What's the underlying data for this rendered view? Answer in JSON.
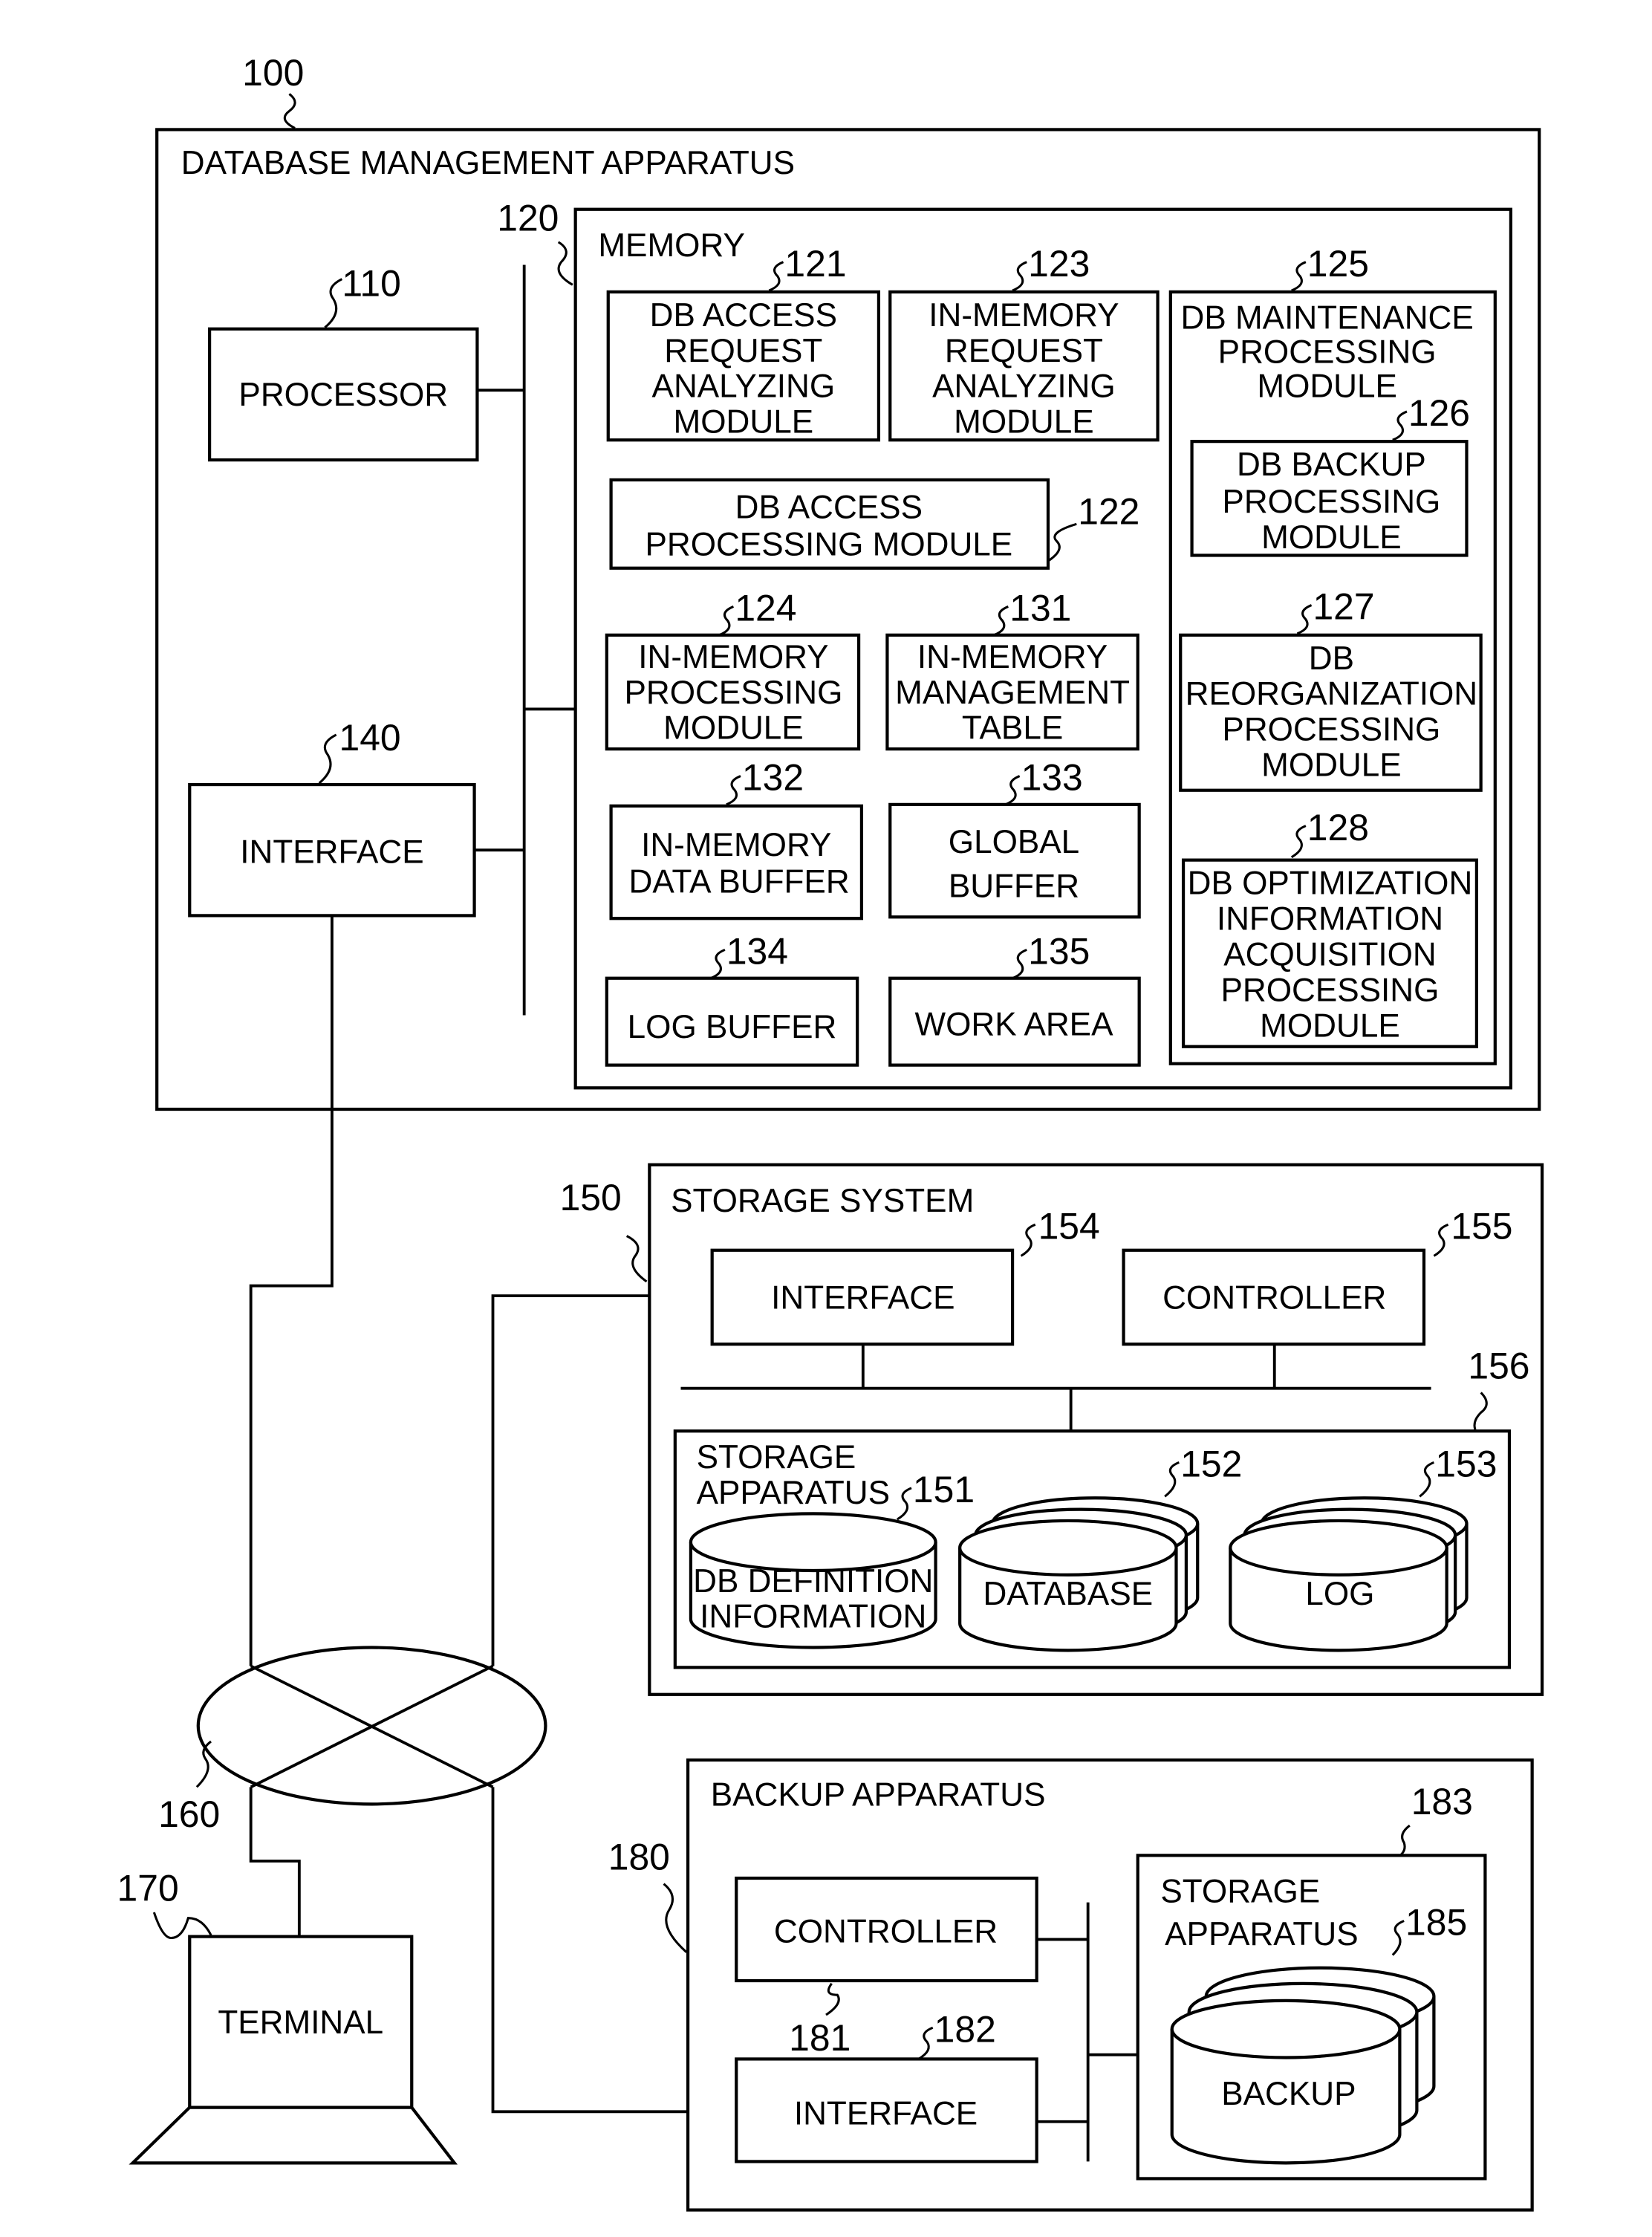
{
  "figure": {
    "dbms": {
      "ref": "100",
      "title": "DATABASE MANAGEMENT APPARATUS",
      "processor": {
        "ref": "110",
        "label": "PROCESSOR"
      },
      "interface": {
        "ref": "140",
        "label": "INTERFACE"
      },
      "memory": {
        "ref": "120",
        "title": "MEMORY",
        "modules": [
          {
            "ref": "121",
            "lines": [
              "DB ACCESS",
              "REQUEST",
              "ANALYZING",
              "MODULE"
            ]
          },
          {
            "ref": "123",
            "lines": [
              "IN-MEMORY",
              "REQUEST",
              "ANALYZING",
              "MODULE"
            ]
          },
          {
            "ref": "122",
            "lines": [
              "DB ACCESS",
              "PROCESSING MODULE"
            ]
          },
          {
            "ref": "124",
            "lines": [
              "IN-MEMORY",
              "PROCESSING",
              "MODULE"
            ]
          },
          {
            "ref": "131",
            "lines": [
              "IN-MEMORY",
              "MANAGEMENT",
              "TABLE"
            ]
          },
          {
            "ref": "132",
            "lines": [
              "IN-MEMORY",
              "DATA BUFFER"
            ]
          },
          {
            "ref": "133",
            "lines": [
              "GLOBAL",
              "BUFFER"
            ]
          },
          {
            "ref": "134",
            "lines": [
              "LOG BUFFER"
            ]
          },
          {
            "ref": "135",
            "lines": [
              "WORK AREA"
            ]
          }
        ],
        "maintenance": {
          "ref": "125",
          "lines": [
            "DB MAINTENANCE",
            "PROCESSING",
            "MODULE"
          ],
          "submodules": [
            {
              "ref": "126",
              "lines": [
                "DB BACKUP",
                "PROCESSING",
                "MODULE"
              ]
            },
            {
              "ref": "127",
              "lines": [
                "DB",
                "REORGANIZATION",
                "PROCESSING",
                "MODULE"
              ]
            },
            {
              "ref": "128",
              "lines": [
                "DB OPTIMIZATION",
                "INFORMATION",
                "ACQUISITION",
                "PROCESSING",
                "MODULE"
              ]
            }
          ]
        }
      }
    },
    "storage_system": {
      "ref": "150",
      "title": "STORAGE SYSTEM",
      "interface": {
        "ref": "154",
        "label": "INTERFACE"
      },
      "controller": {
        "ref": "155",
        "label": "CONTROLLER"
      },
      "storage_apparatus": {
        "ref": "156",
        "lines": [
          "STORAGE",
          "APPARATUS"
        ],
        "volumes": [
          {
            "ref": "151",
            "lines": [
              "DB DEFINITION",
              "INFORMATION"
            ]
          },
          {
            "ref": "152",
            "lines": [
              "DATABASE"
            ]
          },
          {
            "ref": "153",
            "lines": [
              "LOG"
            ]
          }
        ]
      }
    },
    "network": {
      "ref": "160"
    },
    "terminal": {
      "ref": "170",
      "label": "TERMINAL"
    },
    "backup_apparatus": {
      "ref": "180",
      "title": "BACKUP APPARATUS",
      "controller": {
        "ref": "181",
        "label": "CONTROLLER"
      },
      "interface": {
        "ref": "182",
        "label": "INTERFACE"
      },
      "storage_apparatus": {
        "ref": "183",
        "lines": [
          "STORAGE",
          "APPARATUS"
        ],
        "volume": {
          "ref": "185",
          "label": "BACKUP"
        }
      }
    }
  }
}
